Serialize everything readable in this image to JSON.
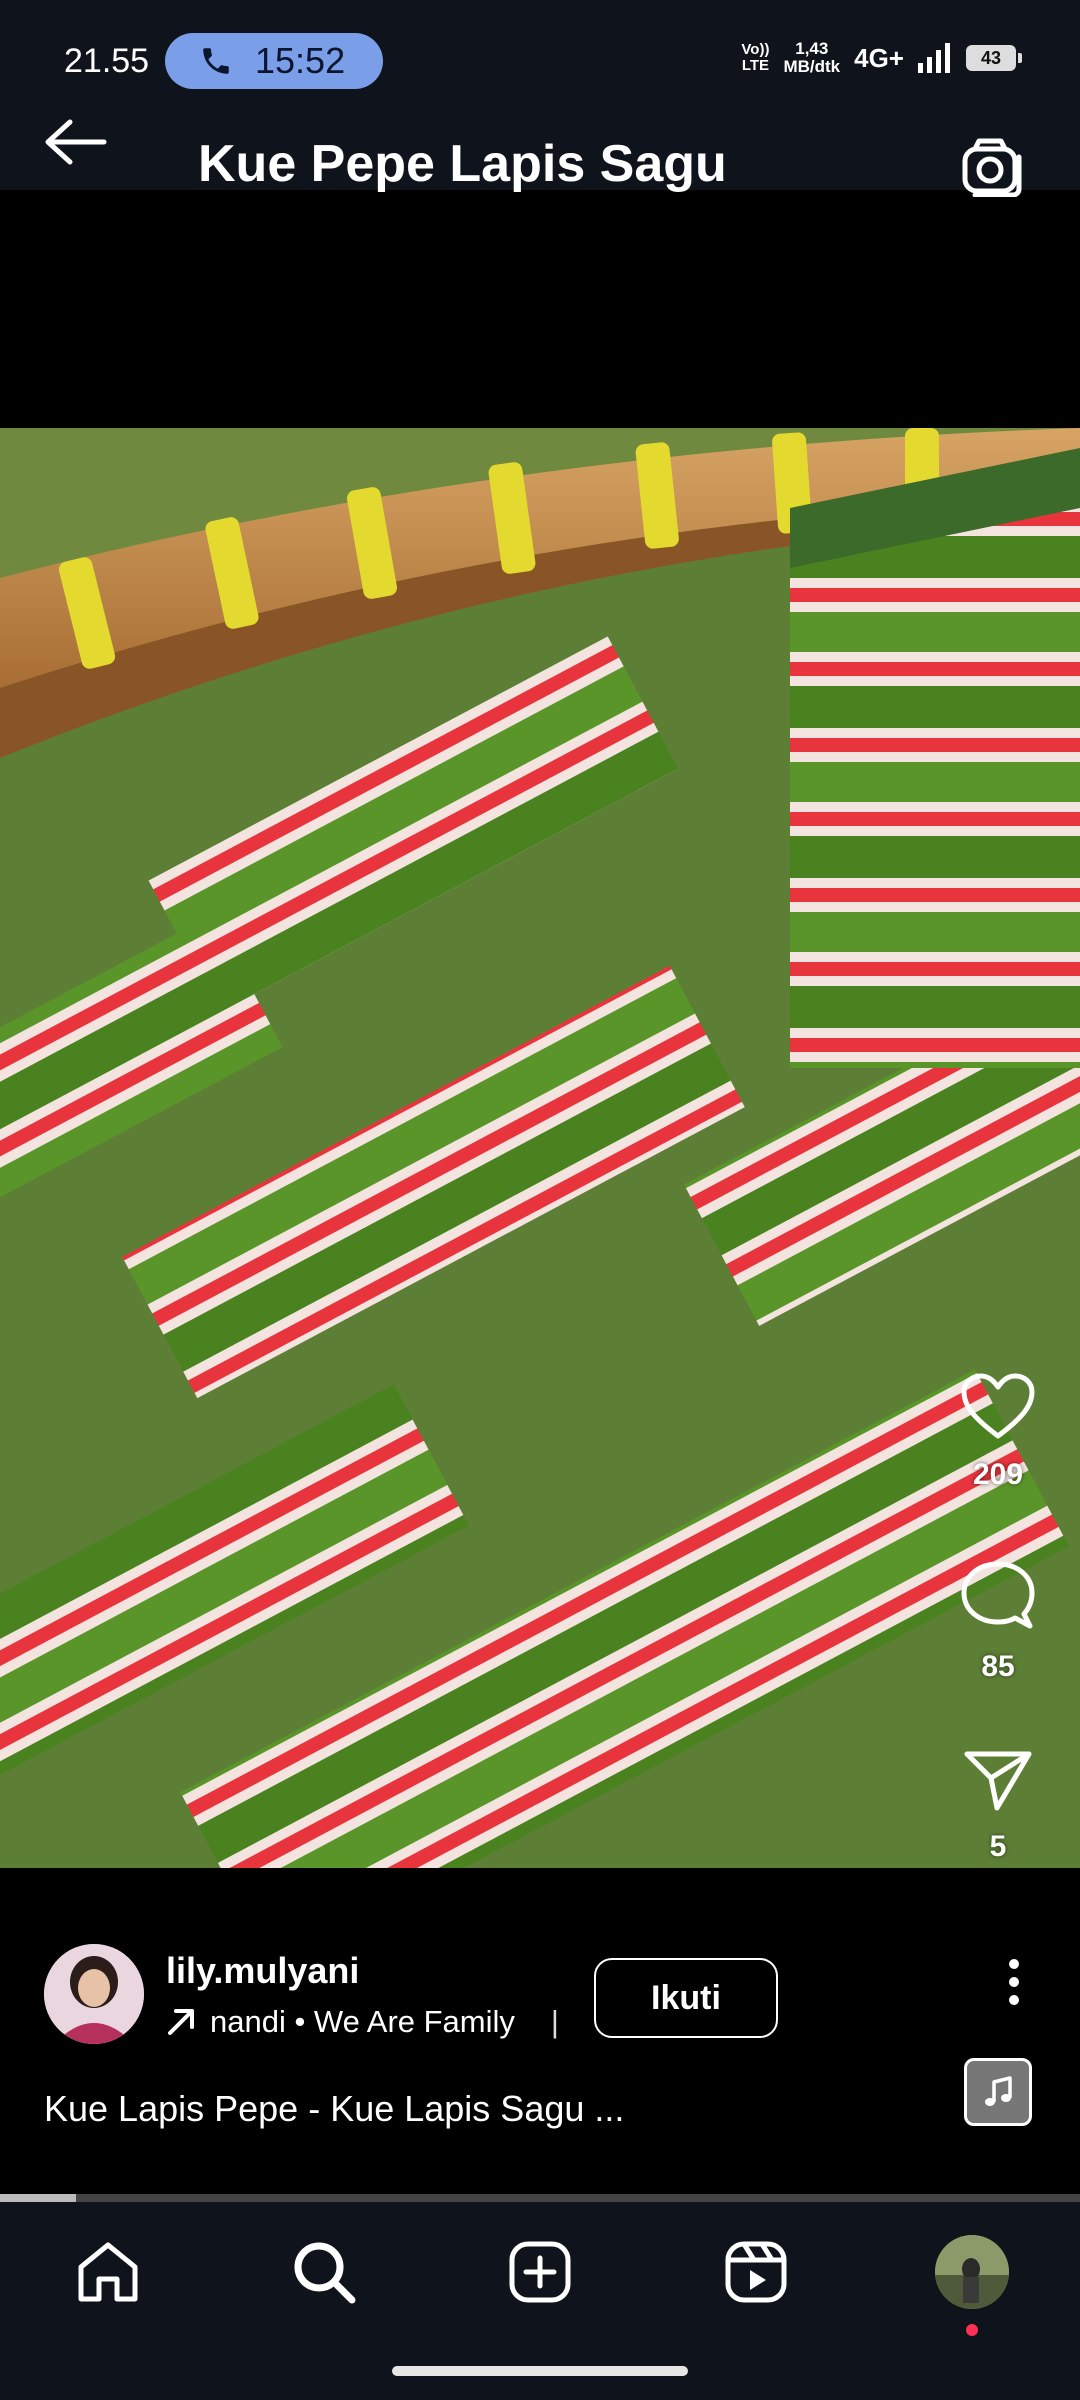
{
  "status_bar": {
    "time": "21.55",
    "call_time": "15:52",
    "volte_top": "Vo))",
    "volte_bottom": "LTE",
    "speed_top": "1,43",
    "speed_bottom": "MB/dtk",
    "network": "4G+",
    "battery": "43"
  },
  "header": {
    "title": "Kue Pepe Lapis Sagu"
  },
  "actions": {
    "likes": "209",
    "comments": "85",
    "shares": "5"
  },
  "post": {
    "username": "lily.mulyani",
    "audio": "nandi • We Are Family",
    "audio_separator": "|",
    "follow_label": "Ikuti",
    "caption": "Kue Lapis Pepe - Kue Lapis Sagu ..."
  },
  "progress": {
    "fraction": 0.07
  },
  "colors": {
    "background": "#000000",
    "bar_background": "#0f131b",
    "call_pill": "#7a9ee8",
    "cake_green": "#4f8a22",
    "cake_red": "#e8353d",
    "cake_white": "#f3e4e0",
    "notification_dot": "#ff2f55"
  },
  "icons": {
    "back": "arrow-left-icon",
    "camera": "camera-icon",
    "like": "heart-icon",
    "comment": "comment-bubble-icon",
    "share": "paper-plane-icon",
    "more": "more-vertical-icon",
    "nav": [
      "home-icon",
      "search-icon",
      "create-icon",
      "reels-icon",
      "profile-avatar"
    ]
  }
}
